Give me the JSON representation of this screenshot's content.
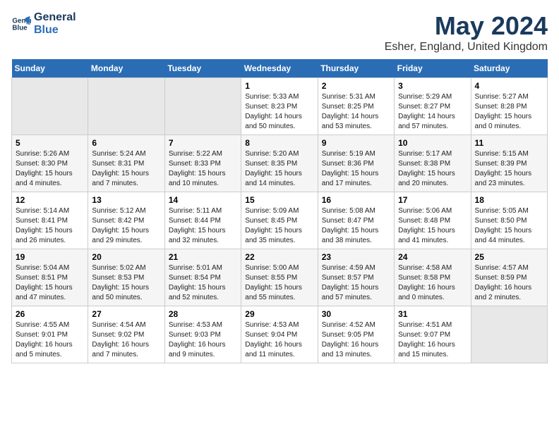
{
  "logo": {
    "line1": "General",
    "line2": "Blue"
  },
  "title": "May 2024",
  "subtitle": "Esher, England, United Kingdom",
  "days_header": [
    "Sunday",
    "Monday",
    "Tuesday",
    "Wednesday",
    "Thursday",
    "Friday",
    "Saturday"
  ],
  "weeks": [
    [
      {
        "num": "",
        "info": ""
      },
      {
        "num": "",
        "info": ""
      },
      {
        "num": "",
        "info": ""
      },
      {
        "num": "1",
        "info": "Sunrise: 5:33 AM\nSunset: 8:23 PM\nDaylight: 14 hours\nand 50 minutes."
      },
      {
        "num": "2",
        "info": "Sunrise: 5:31 AM\nSunset: 8:25 PM\nDaylight: 14 hours\nand 53 minutes."
      },
      {
        "num": "3",
        "info": "Sunrise: 5:29 AM\nSunset: 8:27 PM\nDaylight: 14 hours\nand 57 minutes."
      },
      {
        "num": "4",
        "info": "Sunrise: 5:27 AM\nSunset: 8:28 PM\nDaylight: 15 hours\nand 0 minutes."
      }
    ],
    [
      {
        "num": "5",
        "info": "Sunrise: 5:26 AM\nSunset: 8:30 PM\nDaylight: 15 hours\nand 4 minutes."
      },
      {
        "num": "6",
        "info": "Sunrise: 5:24 AM\nSunset: 8:31 PM\nDaylight: 15 hours\nand 7 minutes."
      },
      {
        "num": "7",
        "info": "Sunrise: 5:22 AM\nSunset: 8:33 PM\nDaylight: 15 hours\nand 10 minutes."
      },
      {
        "num": "8",
        "info": "Sunrise: 5:20 AM\nSunset: 8:35 PM\nDaylight: 15 hours\nand 14 minutes."
      },
      {
        "num": "9",
        "info": "Sunrise: 5:19 AM\nSunset: 8:36 PM\nDaylight: 15 hours\nand 17 minutes."
      },
      {
        "num": "10",
        "info": "Sunrise: 5:17 AM\nSunset: 8:38 PM\nDaylight: 15 hours\nand 20 minutes."
      },
      {
        "num": "11",
        "info": "Sunrise: 5:15 AM\nSunset: 8:39 PM\nDaylight: 15 hours\nand 23 minutes."
      }
    ],
    [
      {
        "num": "12",
        "info": "Sunrise: 5:14 AM\nSunset: 8:41 PM\nDaylight: 15 hours\nand 26 minutes."
      },
      {
        "num": "13",
        "info": "Sunrise: 5:12 AM\nSunset: 8:42 PM\nDaylight: 15 hours\nand 29 minutes."
      },
      {
        "num": "14",
        "info": "Sunrise: 5:11 AM\nSunset: 8:44 PM\nDaylight: 15 hours\nand 32 minutes."
      },
      {
        "num": "15",
        "info": "Sunrise: 5:09 AM\nSunset: 8:45 PM\nDaylight: 15 hours\nand 35 minutes."
      },
      {
        "num": "16",
        "info": "Sunrise: 5:08 AM\nSunset: 8:47 PM\nDaylight: 15 hours\nand 38 minutes."
      },
      {
        "num": "17",
        "info": "Sunrise: 5:06 AM\nSunset: 8:48 PM\nDaylight: 15 hours\nand 41 minutes."
      },
      {
        "num": "18",
        "info": "Sunrise: 5:05 AM\nSunset: 8:50 PM\nDaylight: 15 hours\nand 44 minutes."
      }
    ],
    [
      {
        "num": "19",
        "info": "Sunrise: 5:04 AM\nSunset: 8:51 PM\nDaylight: 15 hours\nand 47 minutes."
      },
      {
        "num": "20",
        "info": "Sunrise: 5:02 AM\nSunset: 8:53 PM\nDaylight: 15 hours\nand 50 minutes."
      },
      {
        "num": "21",
        "info": "Sunrise: 5:01 AM\nSunset: 8:54 PM\nDaylight: 15 hours\nand 52 minutes."
      },
      {
        "num": "22",
        "info": "Sunrise: 5:00 AM\nSunset: 8:55 PM\nDaylight: 15 hours\nand 55 minutes."
      },
      {
        "num": "23",
        "info": "Sunrise: 4:59 AM\nSunset: 8:57 PM\nDaylight: 15 hours\nand 57 minutes."
      },
      {
        "num": "24",
        "info": "Sunrise: 4:58 AM\nSunset: 8:58 PM\nDaylight: 16 hours\nand 0 minutes."
      },
      {
        "num": "25",
        "info": "Sunrise: 4:57 AM\nSunset: 8:59 PM\nDaylight: 16 hours\nand 2 minutes."
      }
    ],
    [
      {
        "num": "26",
        "info": "Sunrise: 4:55 AM\nSunset: 9:01 PM\nDaylight: 16 hours\nand 5 minutes."
      },
      {
        "num": "27",
        "info": "Sunrise: 4:54 AM\nSunset: 9:02 PM\nDaylight: 16 hours\nand 7 minutes."
      },
      {
        "num": "28",
        "info": "Sunrise: 4:53 AM\nSunset: 9:03 PM\nDaylight: 16 hours\nand 9 minutes."
      },
      {
        "num": "29",
        "info": "Sunrise: 4:53 AM\nSunset: 9:04 PM\nDaylight: 16 hours\nand 11 minutes."
      },
      {
        "num": "30",
        "info": "Sunrise: 4:52 AM\nSunset: 9:05 PM\nDaylight: 16 hours\nand 13 minutes."
      },
      {
        "num": "31",
        "info": "Sunrise: 4:51 AM\nSunset: 9:07 PM\nDaylight: 16 hours\nand 15 minutes."
      },
      {
        "num": "",
        "info": ""
      }
    ]
  ]
}
